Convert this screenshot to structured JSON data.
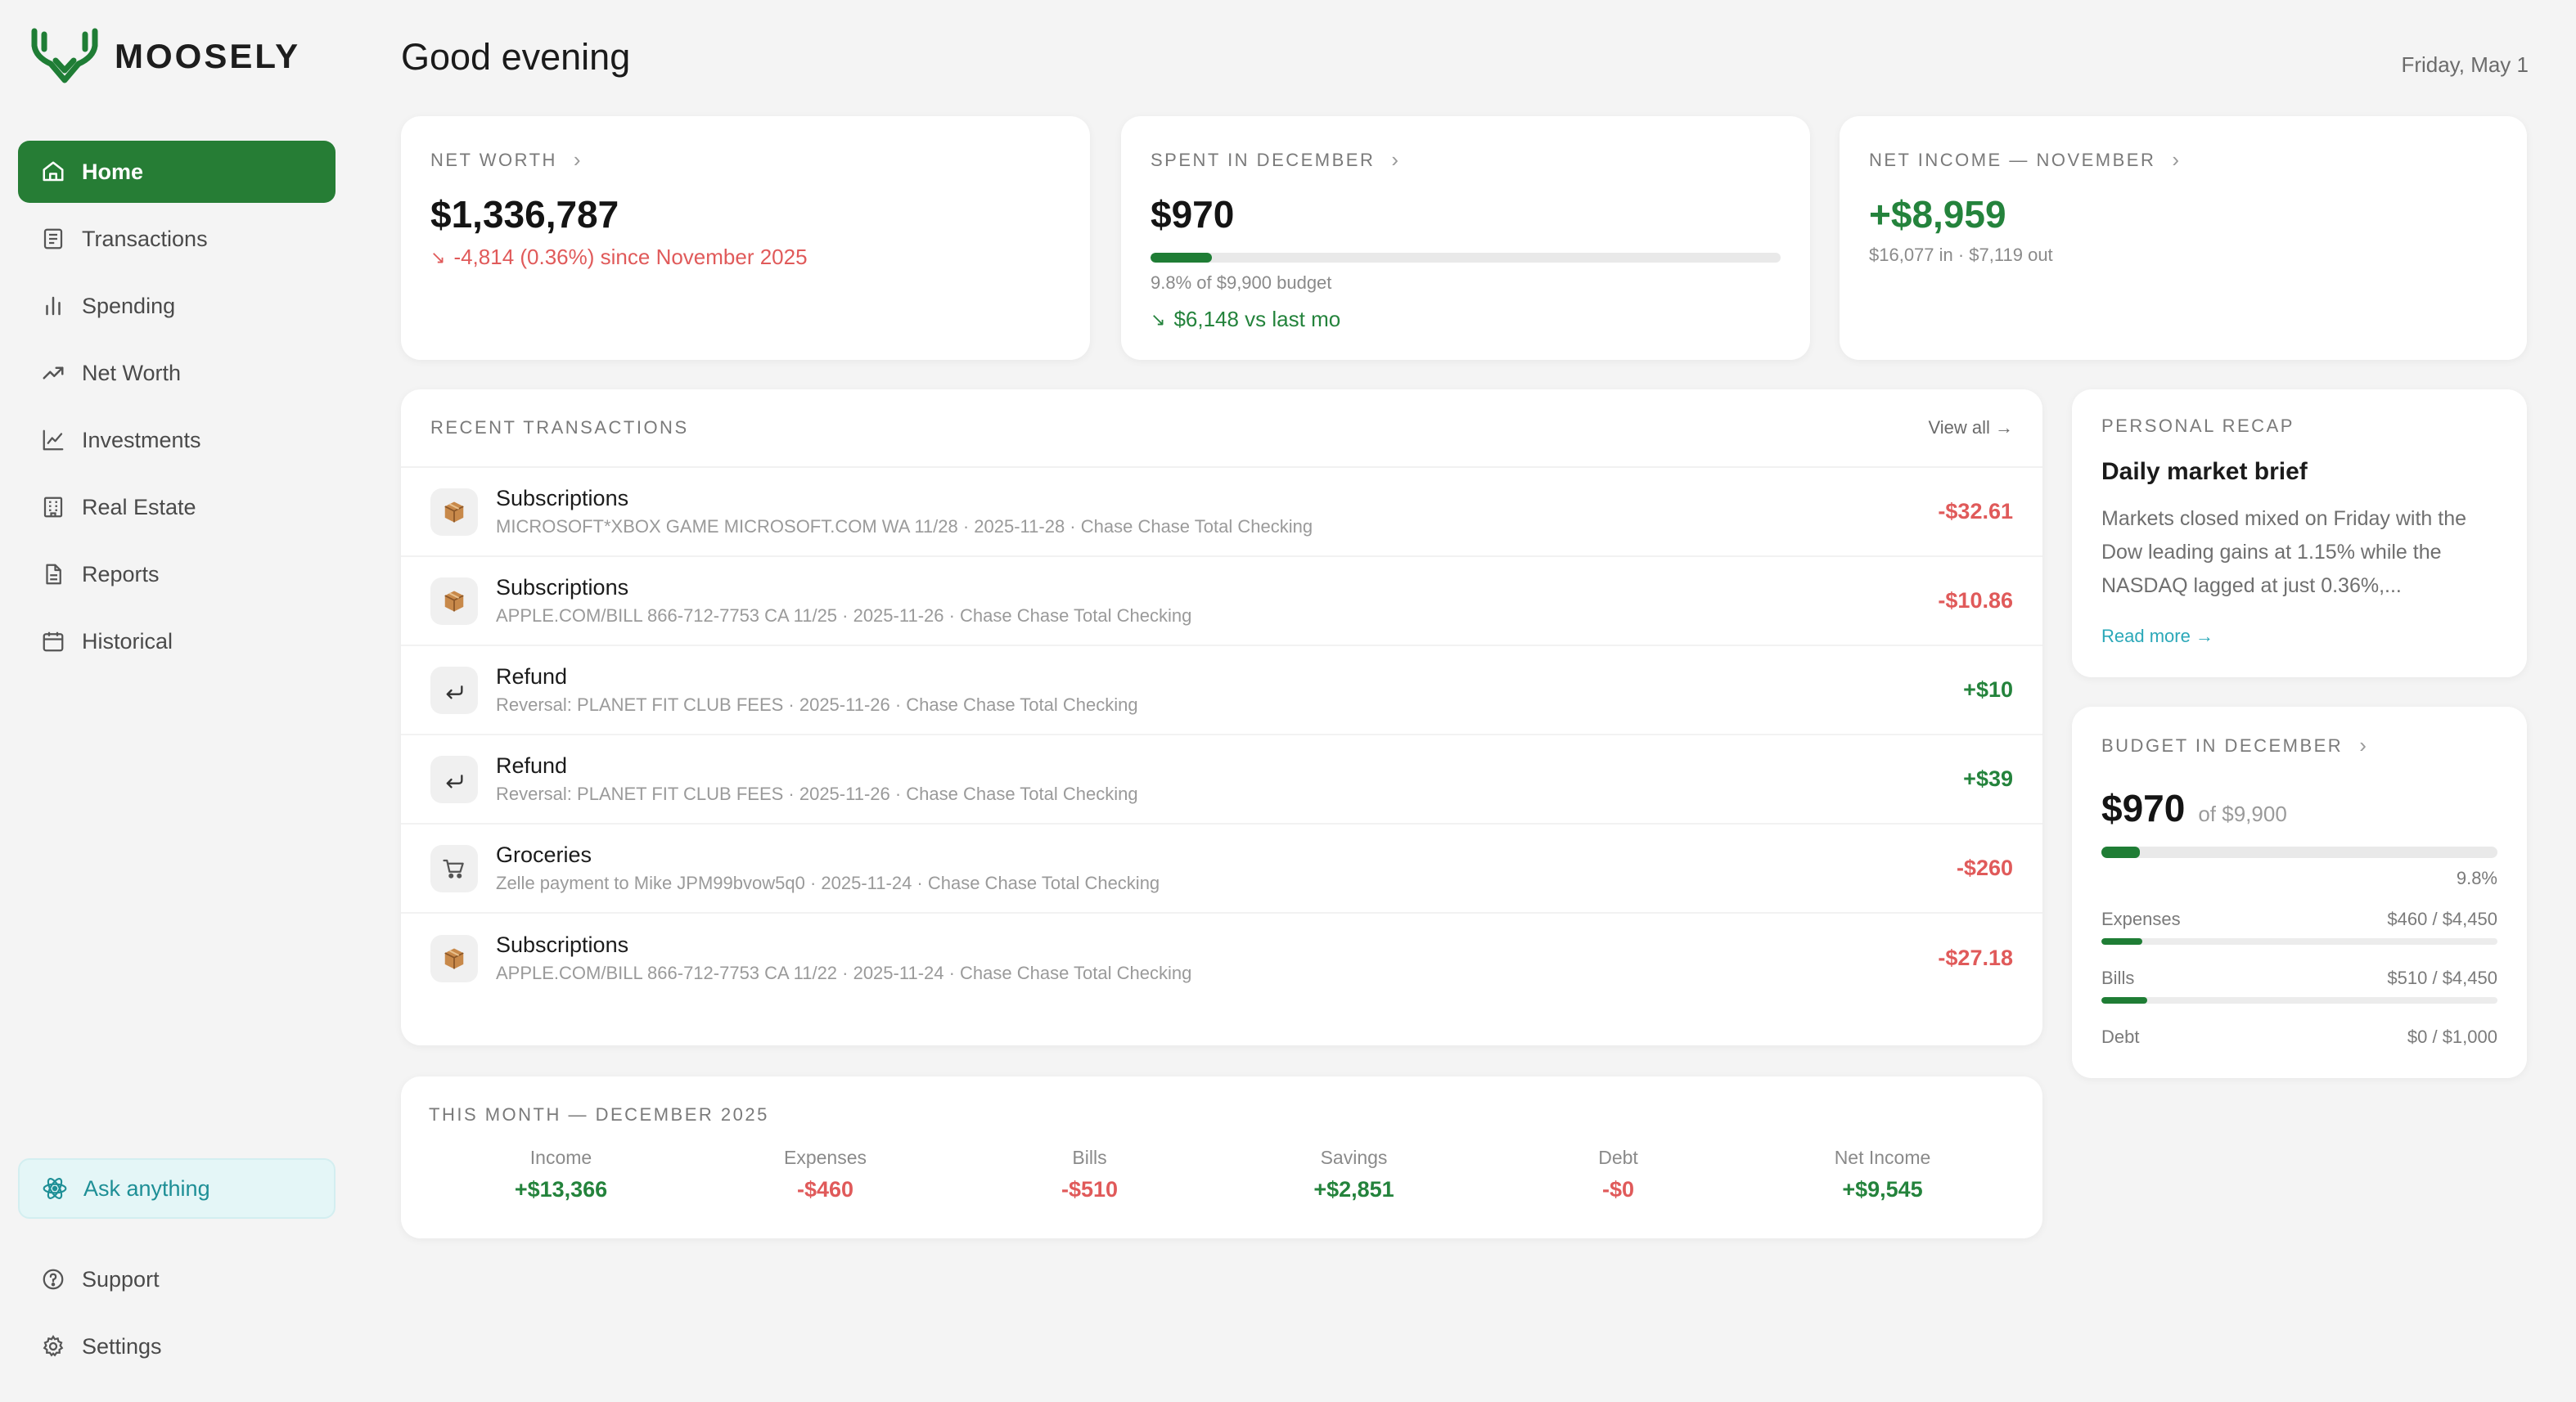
{
  "app": {
    "name": "MOOSELY"
  },
  "sidebar": {
    "items": [
      {
        "label": "Home",
        "icon": "home-icon",
        "active": true
      },
      {
        "label": "Transactions",
        "icon": "receipt-icon"
      },
      {
        "label": "Spending",
        "icon": "bar-chart-icon"
      },
      {
        "label": "Net Worth",
        "icon": "trend-up-icon"
      },
      {
        "label": "Investments",
        "icon": "line-chart-icon"
      },
      {
        "label": "Real Estate",
        "icon": "building-icon"
      },
      {
        "label": "Reports",
        "icon": "document-icon"
      },
      {
        "label": "Historical",
        "icon": "calendar-icon"
      }
    ],
    "ask_label": "Ask anything",
    "bottom": [
      {
        "label": "Support",
        "icon": "help-circle-icon"
      },
      {
        "label": "Settings",
        "icon": "gear-icon"
      }
    ]
  },
  "header": {
    "greeting": "Good evening",
    "date": "Friday, May 1"
  },
  "kpis": {
    "net_worth": {
      "label": "NET WORTH",
      "value": "$1,336,787",
      "change": "-4,814 (0.36%) since November 2025"
    },
    "spent": {
      "label": "SPENT IN DECEMBER",
      "value": "$970",
      "progress": 0.098,
      "budget_text": "9.8% of $9,900 budget",
      "vs_last": "$6,148 vs last mo"
    },
    "net_income": {
      "label": "NET INCOME — NOVEMBER",
      "value": "+$8,959",
      "detail": "$16,077 in · $7,119 out"
    }
  },
  "transactions": {
    "label": "RECENT TRANSACTIONS",
    "view_all": "View all →",
    "rows": [
      {
        "title": "Subscriptions",
        "desc": "MICROSOFT*XBOX GAME MICROSOFT.COM WA 11/28 · 2025-11-28 · Chase Chase Total Checking",
        "amount": "-$32.61",
        "kind": "negative",
        "icon": "package-icon"
      },
      {
        "title": "Subscriptions",
        "desc": "APPLE.COM/BILL 866-712-7753 CA 11/25 · 2025-11-26 · Chase Chase Total Checking",
        "amount": "-$10.86",
        "kind": "negative",
        "icon": "package-icon"
      },
      {
        "title": "Refund",
        "desc": "Reversal: PLANET FIT CLUB FEES · 2025-11-26 · Chase Chase Total Checking",
        "amount": "+$10",
        "kind": "positive",
        "icon": "return-arrow-icon"
      },
      {
        "title": "Refund",
        "desc": "Reversal: PLANET FIT CLUB FEES · 2025-11-26 · Chase Chase Total Checking",
        "amount": "+$39",
        "kind": "positive",
        "icon": "return-arrow-icon"
      },
      {
        "title": "Groceries",
        "desc": "Zelle payment to Mike JPM99bvow5q0 · 2025-11-24 · Chase Chase Total Checking",
        "amount": "-$260",
        "kind": "negative",
        "icon": "cart-icon"
      },
      {
        "title": "Subscriptions",
        "desc": "APPLE.COM/BILL 866-712-7753 CA 11/22 · 2025-11-24 · Chase Chase Total Checking",
        "amount": "-$27.18",
        "kind": "negative",
        "icon": "package-icon"
      }
    ]
  },
  "this_month": {
    "label": "THIS MONTH — DECEMBER 2025",
    "cols": [
      {
        "name": "Income",
        "value": "+$13,366",
        "kind": "positive"
      },
      {
        "name": "Expenses",
        "value": "-$460",
        "kind": "negative"
      },
      {
        "name": "Bills",
        "value": "-$510",
        "kind": "negative"
      },
      {
        "name": "Savings",
        "value": "+$2,851",
        "kind": "positive"
      },
      {
        "name": "Debt",
        "value": "-$0",
        "kind": "negative"
      },
      {
        "name": "Net Income",
        "value": "+$9,545",
        "kind": "positive"
      }
    ]
  },
  "recap": {
    "label": "PERSONAL RECAP",
    "title": "Daily market brief",
    "body": "Markets closed mixed on Friday with the Dow leading gains at 1.15% while the NASDAQ lagged at just 0.36%,...",
    "read_more": "Read more →"
  },
  "budget": {
    "label": "BUDGET IN DECEMBER",
    "value": "$970",
    "of": "of $9,900",
    "progress": 0.098,
    "pct": "9.8%",
    "lines": [
      {
        "name": "Expenses",
        "value": "$460 / $4,450",
        "progress": 0.103
      },
      {
        "name": "Bills",
        "value": "$510 / $4,450",
        "progress": 0.115
      },
      {
        "name": "Debt",
        "value": "$0 / $1,000",
        "progress": 0
      }
    ]
  },
  "colors": {
    "accent": "#267d35",
    "positive": "#24833c",
    "negative": "#e05a5a",
    "link": "#2ba8b8"
  }
}
